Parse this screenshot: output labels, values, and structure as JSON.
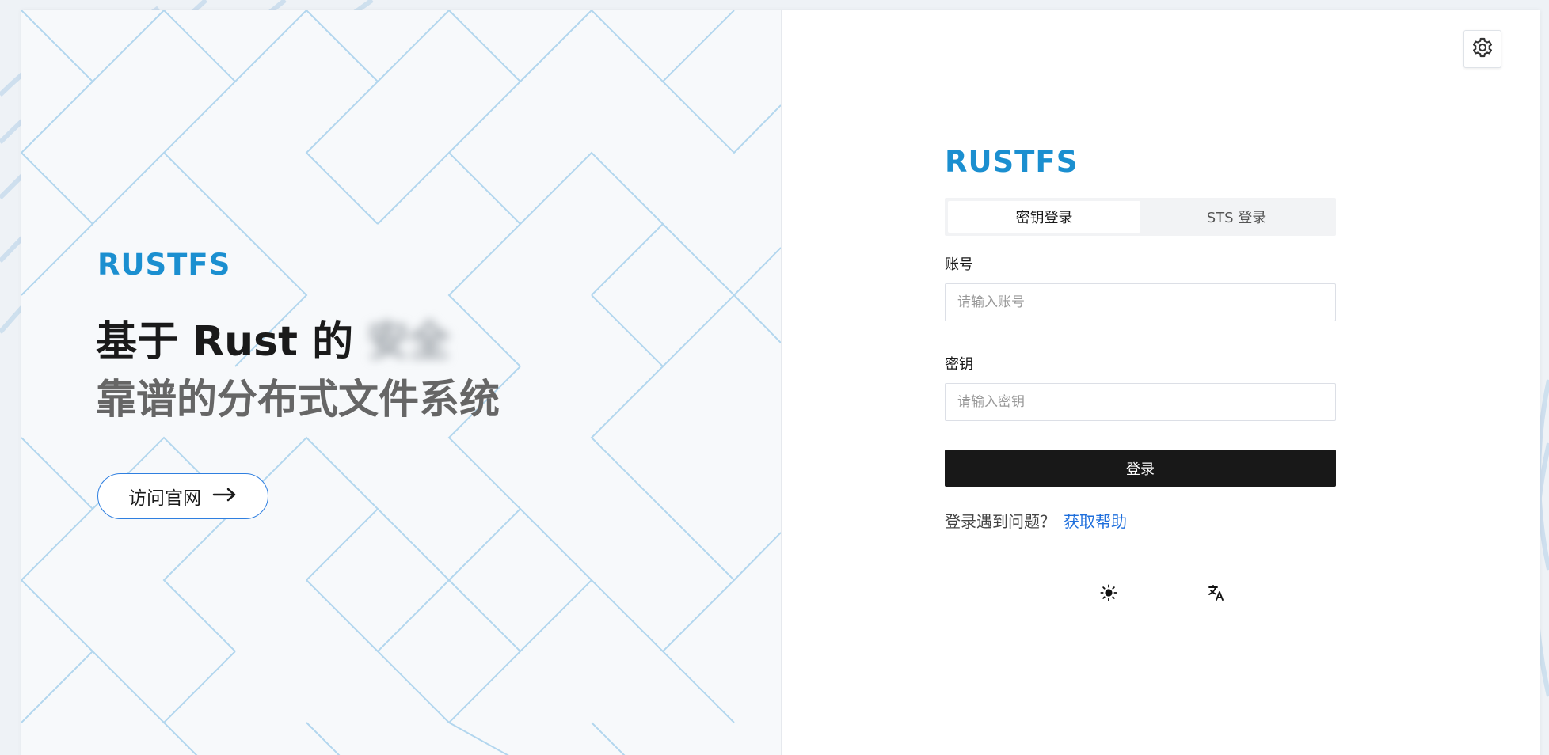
{
  "brand": {
    "logo_text": "RUSTFS",
    "accent_color": "#1b8fd0"
  },
  "hero": {
    "title_line1": "基于 Rust 的",
    "title_line1_blurred": "安全",
    "title_line2": "靠谱的分布式文件系统",
    "visit_button_label": "访问官网",
    "visit_button_icon": "arrow-right-icon"
  },
  "header": {
    "settings_icon": "gear-icon"
  },
  "login": {
    "tabs": [
      {
        "label": "密钥登录",
        "active": true
      },
      {
        "label": "STS 登录",
        "active": false
      }
    ],
    "account": {
      "label": "账号",
      "placeholder": "请输入账号",
      "value": ""
    },
    "secret": {
      "label": "密钥",
      "placeholder": "请输入密钥",
      "value": ""
    },
    "submit_label": "登录",
    "help_prompt": "登录遇到问题？",
    "help_link": "获取帮助"
  },
  "utilities": {
    "theme_icon": "sun-icon",
    "language_icon": "translate-icon"
  },
  "colors": {
    "primary_button": "#181818",
    "link": "#1f6fdc",
    "visit_border": "#2f7fe0"
  }
}
